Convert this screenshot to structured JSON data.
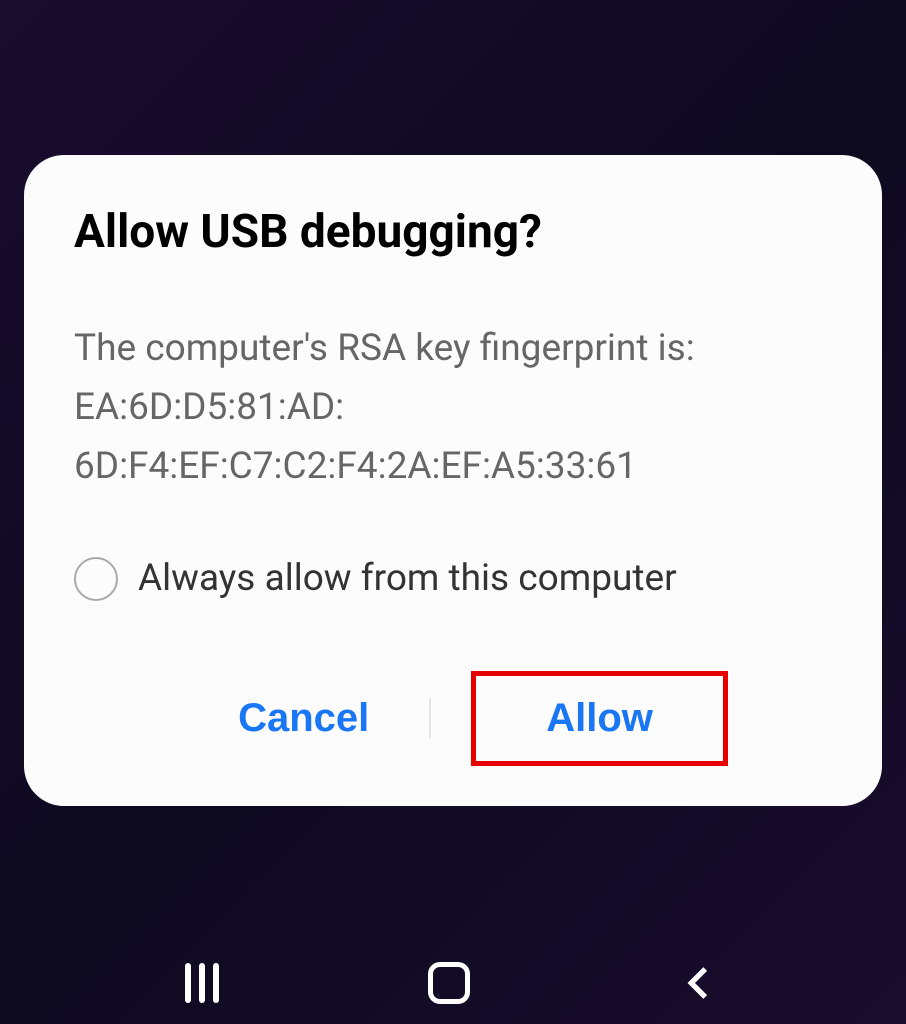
{
  "dialog": {
    "title": "Allow USB debugging?",
    "message_line1": "The computer's RSA key fingerprint is:",
    "message_line2": "EA:6D:D5:81:AD:",
    "message_line3": "6D:F4:EF:C7:C2:F4:2A:EF:A5:33:61",
    "checkbox_label": "Always allow from this computer",
    "cancel_label": "Cancel",
    "allow_label": "Allow"
  }
}
